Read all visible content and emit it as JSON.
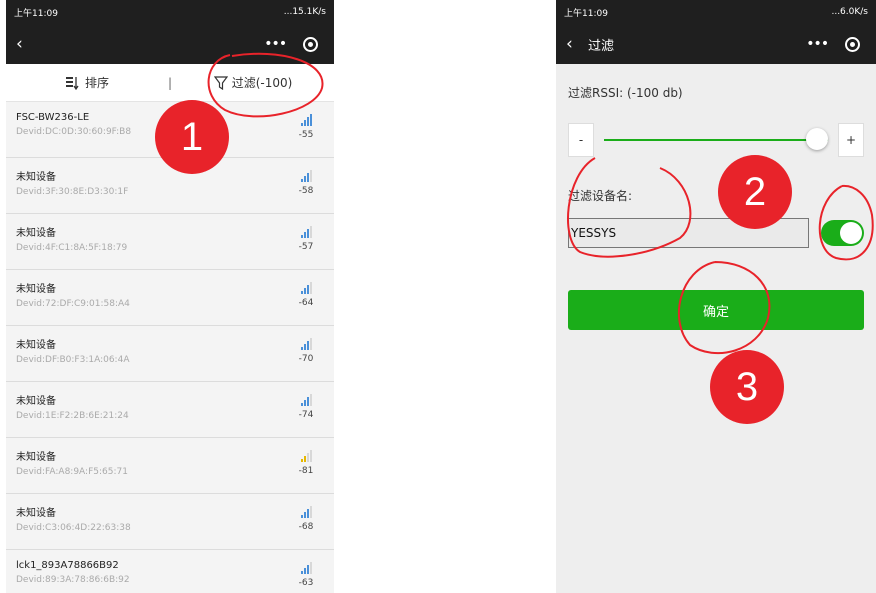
{
  "left": {
    "status": {
      "time": "上午11:09",
      "right": "...15.1K/s"
    },
    "toolbar": {
      "sort_label": "排序",
      "separator": "|",
      "filter_label": "过滤(-100)"
    },
    "devices": [
      {
        "name": "FSC-BW236-LE",
        "devid": "Devid:DC:0D:30:60:9F:B8",
        "rssi": "-55",
        "level": 4,
        "color": "#4a90d9"
      },
      {
        "name": "未知设备",
        "devid": "Devid:3F:30:8E:D3:30:1F",
        "rssi": "-58",
        "level": 3,
        "color": "#4a90d9"
      },
      {
        "name": "未知设备",
        "devid": "Devid:4F:C1:8A:5F:18:79",
        "rssi": "-57",
        "level": 3,
        "color": "#4a90d9"
      },
      {
        "name": "未知设备",
        "devid": "Devid:72:DF:C9:01:58:A4",
        "rssi": "-64",
        "level": 3,
        "color": "#4a90d9"
      },
      {
        "name": "未知设备",
        "devid": "Devid:DF:B0:F3:1A:06:4A",
        "rssi": "-70",
        "level": 3,
        "color": "#4a90d9"
      },
      {
        "name": "未知设备",
        "devid": "Devid:1E:F2:2B:6E:21:24",
        "rssi": "-74",
        "level": 3,
        "color": "#4a90d9"
      },
      {
        "name": "未知设备",
        "devid": "Devid:FA:A8:9A:F5:65:71",
        "rssi": "-81",
        "level": 2,
        "color": "#e6b800"
      },
      {
        "name": "未知设备",
        "devid": "Devid:C3:06:4D:22:63:38",
        "rssi": "-68",
        "level": 3,
        "color": "#4a90d9"
      },
      {
        "name": "lck1_893A78866B92",
        "devid": "Devid:89:3A:78:86:6B:92",
        "rssi": "-63",
        "level": 3,
        "color": "#4a90d9"
      }
    ],
    "badge": "1"
  },
  "right": {
    "status": {
      "time": "上午11:09",
      "right": "...6.0K/s"
    },
    "nav_title": "过滤",
    "rssi_label": "过滤RSSI: (-100 db)",
    "minus_label": "-",
    "plus_label": "+",
    "name_label": "过滤设备名:",
    "name_value": "YESSYS",
    "confirm_label": "确定",
    "badges": [
      "2",
      "3"
    ]
  },
  "colors": {
    "accent": "#1aad19",
    "annotation": "#e8232a"
  }
}
